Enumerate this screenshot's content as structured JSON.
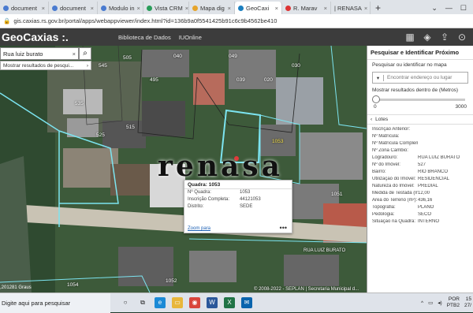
{
  "browser": {
    "tabs": [
      {
        "label": "document",
        "active": false
      },
      {
        "label": "document",
        "active": false
      },
      {
        "label": "Modulo in",
        "active": false
      },
      {
        "label": "Vista CRM",
        "active": false
      },
      {
        "label": "Mapa dig",
        "active": false
      },
      {
        "label": "GeoCaxi",
        "active": true
      },
      {
        "label": "R. Marav",
        "active": false
      },
      {
        "label": "| RENASA",
        "active": false
      }
    ],
    "new_tab": "+",
    "url": "gis.caxias.rs.gov.br/portal/apps/webappviewer/index.html?id=136b9a0f5541425b91c6c9b4562be410"
  },
  "app": {
    "title": "GeoCaxias :.",
    "links": [
      "Biblioteca de Dados",
      "IUOnline"
    ]
  },
  "map": {
    "search_value": "Rua luiz burato",
    "suggest_text": "Mostrar resultados de pesqui...",
    "watermark": "renasa",
    "plot_labels": [
      {
        "text": "535",
        "y": false
      },
      {
        "text": "525",
        "y": false
      },
      {
        "text": "545",
        "y": false
      },
      {
        "text": "515",
        "y": false
      },
      {
        "text": "505",
        "y": false
      },
      {
        "text": "495",
        "y": false
      },
      {
        "text": "039",
        "y": false
      },
      {
        "text": "049",
        "y": false
      },
      {
        "text": "020",
        "y": false
      },
      {
        "text": "030",
        "y": false
      },
      {
        "text": "1053",
        "y": true
      },
      {
        "text": "1052",
        "y": false
      },
      {
        "text": "1054",
        "y": false
      },
      {
        "text": "1051",
        "y": false
      },
      {
        "text": "040",
        "y": false
      }
    ],
    "street_label": "RUA LUIZ BURATO",
    "scale": ",201281 Graus",
    "copyright": "© 2008-2022 - SEPLAN | Secretaria Municipal d..."
  },
  "popup": {
    "title": "Quadra: 1053",
    "rows": [
      {
        "k": "Nº Quadra:",
        "v": "1053"
      },
      {
        "k": "Inscrição Completa:",
        "v": "44121053"
      },
      {
        "k": "Distrito:",
        "v": "SEDE"
      }
    ],
    "zoom": "Zoom para",
    "more": "•••"
  },
  "panel": {
    "title": "Pesquisar e Identificar Próximo",
    "identify_label": "Pesquisar ou identificar no mapa",
    "geocode_placeholder": "Encontrar endereço ou lugar",
    "distance_label": "Mostrar resultados dentro de (Metros)",
    "slider_value": "0",
    "slider_max": "3000",
    "lotes": "Lotes",
    "attrs": [
      {
        "k": "Inscrição Anterior:",
        "v": ""
      },
      {
        "k": "Nº Matrícula:",
        "v": ""
      },
      {
        "k": "Nº Matrícula Complementar:",
        "v": ""
      },
      {
        "k": "Nº Zona Cambio:",
        "v": ""
      },
      {
        "k": "Logradouro:",
        "v": "RUA LUIZ BURATO"
      },
      {
        "k": "Nº do Imóvel:",
        "v": "527"
      },
      {
        "k": "Bairro:",
        "v": "RIO BRANCO"
      },
      {
        "k": "Utilização do Imóvel:",
        "v": "RESIDENCIAL"
      },
      {
        "k": "Natureza do Imóvel:",
        "v": "PREDIAL"
      },
      {
        "k": "Medida de Testada (m):",
        "v": "12,00"
      },
      {
        "k": "Área do Terreno (m²):",
        "v": "436,16"
      },
      {
        "k": "Topografia:",
        "v": "PLANO"
      },
      {
        "k": "Pedologia:",
        "v": "SECO"
      },
      {
        "k": "Situação na Quadra:",
        "v": "INTERNO"
      }
    ]
  },
  "taskbar": {
    "search": "Digite aqui para pesquisar",
    "lang": "POR",
    "lang2": "PTB2",
    "time": "15",
    "date": "27/"
  },
  "colors": {
    "parcel_outline": "#7ce4f0",
    "highlight": "#ffffff",
    "appbar": "#3c3c3c"
  }
}
